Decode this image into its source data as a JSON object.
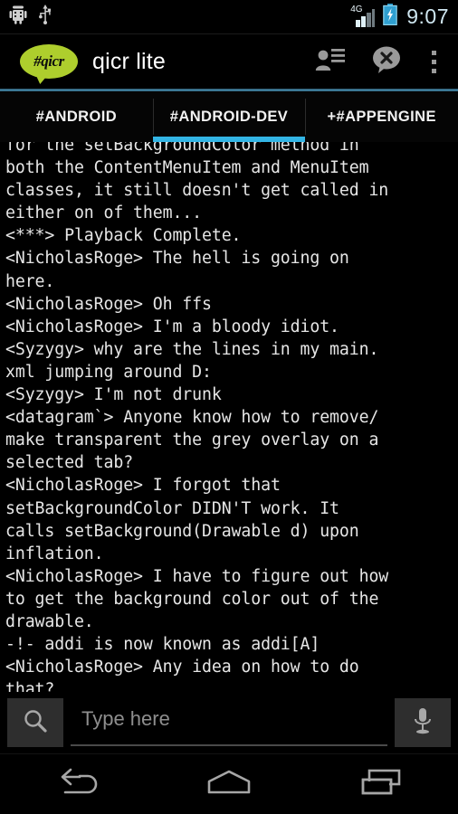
{
  "status_bar": {
    "icons_left": [
      "android-robot-icon",
      "usb-icon"
    ],
    "network_label": "4G",
    "signal_icon": "signal-bars-icon",
    "battery_icon": "battery-charging-icon",
    "time": "9:07"
  },
  "action_bar": {
    "logo_text": "#qicr",
    "title": "qicr lite",
    "actions": [
      {
        "name": "user-list-icon",
        "label": "User list"
      },
      {
        "name": "close-channel-icon",
        "label": "Close channel"
      },
      {
        "name": "overflow-menu-icon",
        "label": "More options"
      }
    ],
    "accent_color": "#33b5e5",
    "logo_color": "#aece2d"
  },
  "tabs": [
    {
      "label": "#ANDROID",
      "selected": false
    },
    {
      "label": "#ANDROID-DEV",
      "selected": true
    },
    {
      "label": "+#APPENGINE",
      "selected": false
    }
  ],
  "chat": {
    "lines": [
      "for the setBackgroundColor method in",
      "both the ContentMenuItem and MenuItem",
      "classes, it still doesn't get called in",
      "either on of them...",
      "<***> Playback Complete.",
      "<NicholasRoge> The hell is going on",
      "here.",
      "<NicholasRoge> Oh ffs",
      "<NicholasRoge> I'm a bloody idiot.",
      "<Syzygy> why are the lines in my main.",
      "xml jumping around D:",
      "<Syzygy> I'm not drunk",
      "<datagram`> Anyone know how to remove/",
      "make transparent the grey overlay on a",
      "selected tab?",
      "<NicholasRoge> I forgot that",
      "setBackgroundColor DIDN'T work. It",
      "calls setBackground(Drawable d) upon",
      "inflation.",
      "<NicholasRoge> I have to figure out how",
      "to get the background color out of the",
      "drawable.",
      "-!- addi is now known as addi[A]",
      "<NicholasRoge> Any idea on how to do",
      "that?"
    ],
    "text_color": "#e6e6e6"
  },
  "input_bar": {
    "search_icon": "search-icon",
    "message_placeholder": "Type here",
    "message_value": "",
    "mic_icon": "microphone-icon"
  },
  "nav_bar": {
    "buttons": [
      {
        "name": "back-button",
        "label": "Back"
      },
      {
        "name": "home-button",
        "label": "Home"
      },
      {
        "name": "recents-button",
        "label": "Recent apps"
      }
    ]
  }
}
